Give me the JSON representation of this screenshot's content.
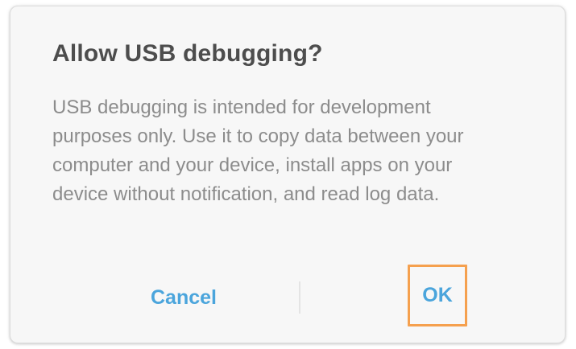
{
  "dialog": {
    "title": "Allow USB debugging?",
    "message": "USB debugging is intended for development purposes only. Use it to copy data between your computer and your device, install apps on your device without notification, and read log data.",
    "buttons": {
      "cancel_label": "Cancel",
      "ok_label": "OK"
    },
    "colors": {
      "button_text": "#4ba5dc",
      "focus_highlight": "#f5a04e",
      "title_text": "#4d4d4d",
      "message_text": "#8c8c8c"
    }
  }
}
